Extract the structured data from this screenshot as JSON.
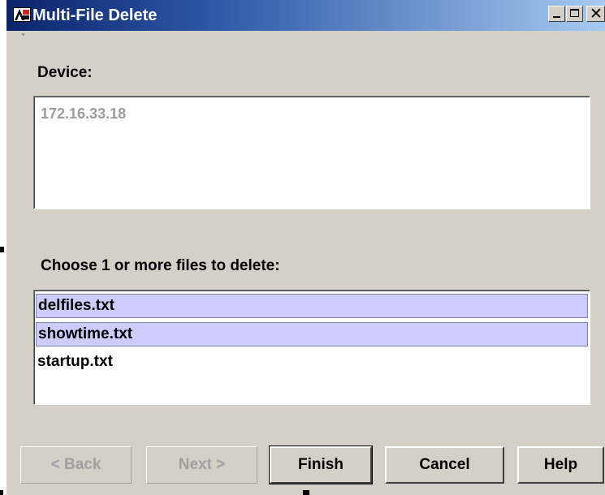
{
  "window": {
    "title": "Multi-File Delete",
    "controls": {
      "minimize": "minimize-icon",
      "maximize": "maximize-icon",
      "close": "close-icon"
    },
    "title_gradient": [
      "#0a246a",
      "#a6caf0"
    ]
  },
  "device": {
    "label": "Device:",
    "value": "172.16.33.18"
  },
  "files": {
    "label": "Choose 1 or more files to delete:",
    "items": [
      {
        "name": "delfiles.txt",
        "selected": true
      },
      {
        "name": "showtime.txt",
        "selected": true
      },
      {
        "name": "startup.txt",
        "selected": false
      }
    ],
    "selection_color": "#ccccff"
  },
  "buttons": {
    "back": {
      "label": "< Back",
      "enabled": false
    },
    "next": {
      "label": "Next >",
      "enabled": false
    },
    "finish": {
      "label": "Finish",
      "enabled": true
    },
    "cancel": {
      "label": "Cancel",
      "enabled": true
    },
    "help": {
      "label": "Help",
      "enabled": true
    }
  }
}
